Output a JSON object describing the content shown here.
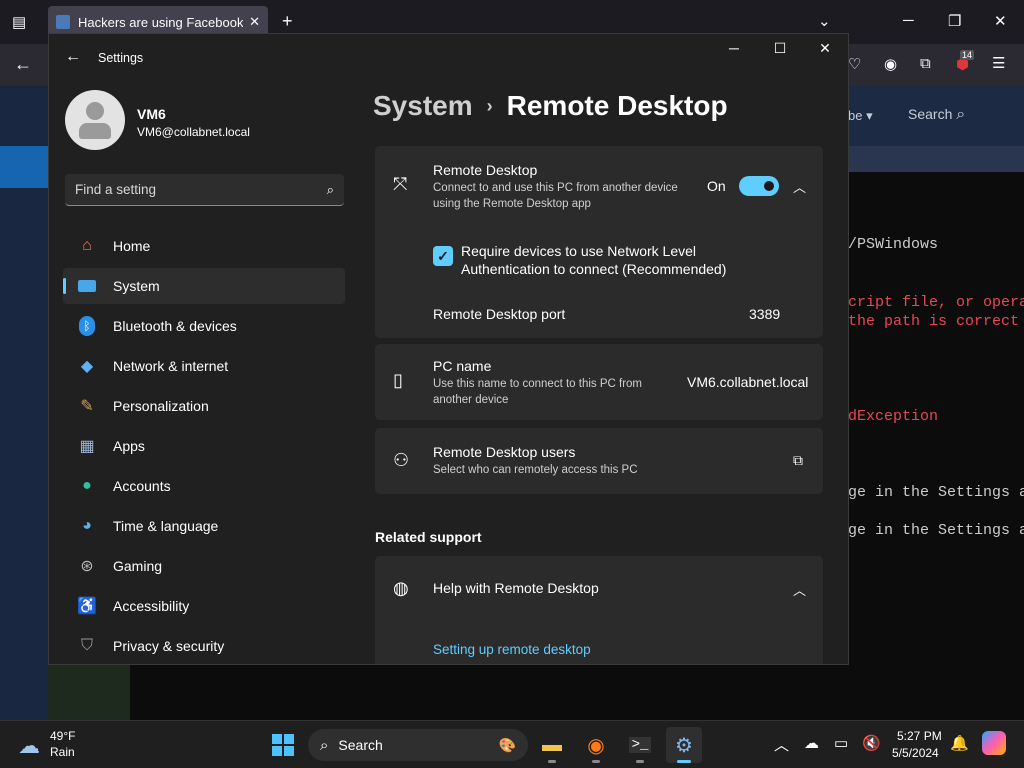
{
  "browser": {
    "tab_title": "Hackers are using Facebook Ma",
    "tab_close": "✕",
    "new_tab": "+",
    "badge_count": "14",
    "website": {
      "subscribe_label": "be ▾",
      "search_label": "Search"
    }
  },
  "terminal": {
    "lines": [
      "/PSWindows",
      "cript file, or opera",
      " the path is correct",
      "dException",
      "ge in the Settings a",
      "ge in the Settings a"
    ]
  },
  "settings": {
    "app_title": "Settings",
    "profile": {
      "name": "VM6",
      "email": "VM6@collabnet.local"
    },
    "search_placeholder": "Find a setting",
    "nav": [
      {
        "label": "Home",
        "icon": "home-icon"
      },
      {
        "label": "System",
        "icon": "system-icon"
      },
      {
        "label": "Bluetooth & devices",
        "icon": "bluetooth-icon"
      },
      {
        "label": "Network & internet",
        "icon": "wifi-icon"
      },
      {
        "label": "Personalization",
        "icon": "brush-icon"
      },
      {
        "label": "Apps",
        "icon": "apps-icon"
      },
      {
        "label": "Accounts",
        "icon": "accounts-icon"
      },
      {
        "label": "Time & language",
        "icon": "globe-clock-icon"
      },
      {
        "label": "Gaming",
        "icon": "gamepad-icon"
      },
      {
        "label": "Accessibility",
        "icon": "accessibility-icon"
      },
      {
        "label": "Privacy & security",
        "icon": "shield-icon"
      }
    ],
    "selected_nav": "System",
    "breadcrumb": {
      "parent": "System",
      "separator": "›",
      "current": "Remote Desktop"
    },
    "remote_desktop": {
      "title": "Remote Desktop",
      "description": "Connect to and use this PC from another device using the Remote Desktop app",
      "state_label": "On",
      "toggle_on": true,
      "nla_label": "Require devices to use Network Level Authentication to connect (Recommended)",
      "nla_checked": true,
      "port_label": "Remote Desktop port",
      "port_value": "3389"
    },
    "pc_name": {
      "title": "PC name",
      "description": "Use this name to connect to this PC from another device",
      "value": "VM6.collabnet.local"
    },
    "rd_users": {
      "title": "Remote Desktop users",
      "description": "Select who can remotely access this PC"
    },
    "related_support": {
      "heading": "Related support",
      "help_title": "Help with Remote Desktop",
      "link": "Setting up remote desktop"
    }
  },
  "taskbar": {
    "weather": {
      "temp": "49°F",
      "condition": "Rain"
    },
    "search_label": "Search",
    "time": "5:27 PM",
    "date": "5/5/2024"
  },
  "colors": {
    "accent": "#60cdff",
    "window_bg": "#202020",
    "card_bg": "#2b2b2b",
    "terminal_red": "#e74856"
  }
}
